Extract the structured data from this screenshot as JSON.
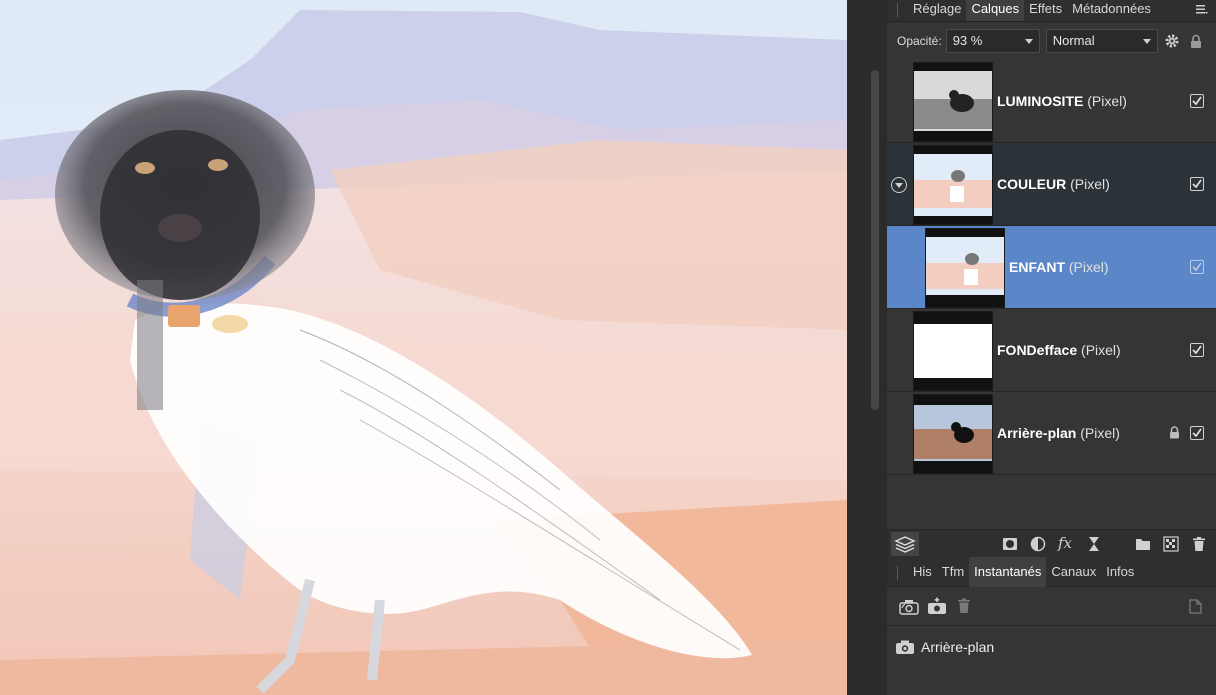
{
  "panel": {
    "top_tabs": [
      {
        "label": "Réglage",
        "active": false
      },
      {
        "label": "Calques",
        "active": true
      },
      {
        "label": "Effets",
        "active": false
      },
      {
        "label": "Métadonnées",
        "active": false
      }
    ],
    "panel_menu_icon": "menu-icon",
    "opacity_label": "Opacité:",
    "opacity_value": "93 %",
    "blend_mode": "Normal",
    "layers": [
      {
        "name": "LUMINOSITE",
        "type": "(Pixel)",
        "visible": true,
        "thumb": "raven-grayscale"
      },
      {
        "name": "COULEUR",
        "type": "(Pixel)",
        "visible": true,
        "thumb": "washed-scene",
        "expanded": true
      },
      {
        "name": "ENFANT",
        "type": "(Pixel)",
        "visible": true,
        "thumb": "washed-scene",
        "selected": true
      },
      {
        "name": "FONDefface",
        "type": "(Pixel)",
        "visible": true,
        "thumb": "white"
      },
      {
        "name": "Arrière-plan",
        "type": "(Pixel)",
        "visible": true,
        "locked": true,
        "thumb": "raven-color"
      }
    ],
    "bottom_tabs": [
      {
        "label": "His",
        "active": false
      },
      {
        "label": "Tfm",
        "active": false
      },
      {
        "label": "Instantanés",
        "active": true
      },
      {
        "label": "Canaux",
        "active": false
      },
      {
        "label": "Infos",
        "active": false
      }
    ],
    "snapshots": [
      {
        "label": "Arrière-plan"
      }
    ]
  },
  "colors": {
    "panel_bg": "#353535",
    "selected_layer": "#5b86c8",
    "group_layer": "#2b3338"
  }
}
